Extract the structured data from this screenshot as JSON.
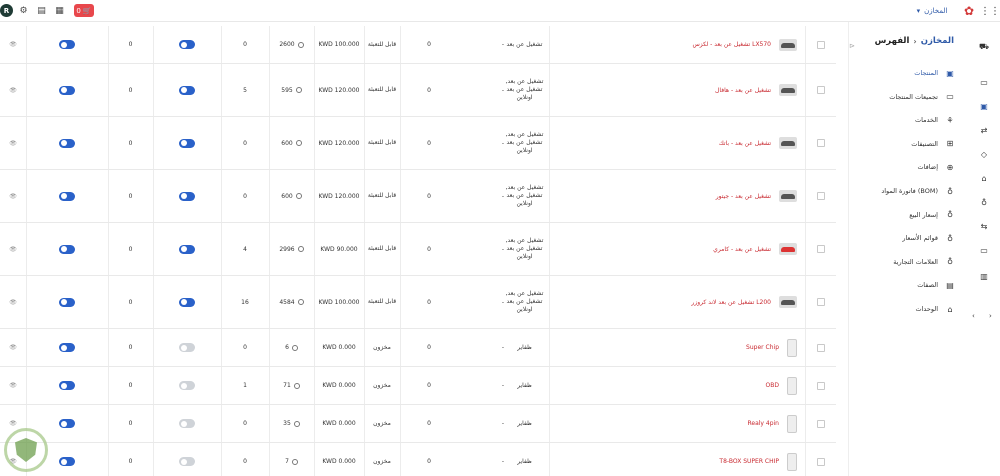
{
  "topbar": {
    "avatar_letter": "R",
    "cart_count": "0",
    "store_select_label": "المخازن",
    "icons": [
      "settings-icon",
      "receipt-icon",
      "qr-icon",
      "cart-icon",
      "brand-logo",
      "apps-grid-icon"
    ]
  },
  "sidebar": {
    "breadcrumb": {
      "root": "المخازن",
      "separator": "›",
      "current": "الفهرس"
    },
    "items": [
      {
        "label": "المنتجات",
        "icon": "product-icon",
        "active": true
      },
      {
        "label": "تجميعات المنتجات",
        "icon": "bundle-icon",
        "active": false
      },
      {
        "label": "الخدمات",
        "icon": "service-icon",
        "active": false
      },
      {
        "label": "التصنيفات",
        "icon": "category-icon",
        "active": false
      },
      {
        "label": "إضافات",
        "icon": "addon-icon",
        "active": false
      },
      {
        "label": "فاتورة المواد (BOM)",
        "icon": "bom-icon",
        "active": false
      },
      {
        "label": "إسعار البيع",
        "icon": "price-icon",
        "active": false
      },
      {
        "label": "قوائم الأسعار",
        "icon": "pricelist-icon",
        "active": false
      },
      {
        "label": "العلامات التجارية",
        "icon": "brand-icon",
        "active": false
      },
      {
        "label": "الصفات",
        "icon": "attribute-icon",
        "active": false
      },
      {
        "label": "الوحدات",
        "icon": "unit-icon",
        "active": false
      }
    ]
  },
  "rail": {
    "icons": [
      "truck-icon",
      "pos-icon",
      "catalog-icon",
      "transfer-icon",
      "tag-icon",
      "store-icon",
      "flow-icon",
      "exchange-icon",
      "card-icon",
      "chart-icon"
    ],
    "arrows": "‹ ›"
  },
  "rows": [
    {
      "name": "تشغيل عن بعد - لكزس LX570",
      "image": "car-dark",
      "type": "تشغيل عن بعد",
      "dash": "-",
      "zero_a": "0",
      "tracking": "قابل للتعبئة",
      "price": "KWD 100.000",
      "stock": "2600",
      "qty": "0",
      "active": true,
      "count": "0",
      "visible": true
    },
    {
      "name": "تشغيل عن بعد - هافال",
      "image": "car-dark",
      "type": "تشغيل عن بعد, تشغيل عن بعد اونلاين",
      "dash": "-",
      "zero_a": "0",
      "tracking": "قابل للتعبئة",
      "price": "KWD 120.000",
      "stock": "595",
      "qty": "5",
      "active": true,
      "count": "0",
      "visible": true
    },
    {
      "name": "تشغيل عن بعد - باتك",
      "image": "car-light",
      "type": "تشغيل عن بعد, تشغيل عن بعد اونلاين",
      "dash": "-",
      "zero_a": "0",
      "tracking": "قابل للتعبئة",
      "price": "KWD 120.000",
      "stock": "600",
      "qty": "0",
      "active": true,
      "count": "0",
      "visible": true
    },
    {
      "name": "تشغيل عن بعد - جيتور",
      "image": "car-dark",
      "type": "تشغيل عن بعد, تشغيل عن بعد اونلاين",
      "dash": "-",
      "zero_a": "0",
      "tracking": "قابل للتعبئة",
      "price": "KWD 120.000",
      "stock": "600",
      "qty": "0",
      "active": true,
      "count": "0",
      "visible": true
    },
    {
      "name": "تشغيل عن بعد - كامري",
      "image": "car-red",
      "type": "تشغيل عن بعد, تشغيل عن بعد اونلاين",
      "dash": "-",
      "zero_a": "0",
      "tracking": "قابل للتعبئة",
      "price": "KWD 90.000",
      "stock": "2996",
      "qty": "4",
      "active": true,
      "count": "0",
      "visible": true
    },
    {
      "name": "تشغيل عن بعد لاند كروزر L200",
      "image": "car-dark",
      "type": "تشغيل عن بعد, تشغيل عن بعد اونلاين",
      "dash": "-",
      "zero_a": "0",
      "tracking": "قابل للتعبئة",
      "price": "KWD 100.000",
      "stock": "4584",
      "qty": "16",
      "active": true,
      "count": "0",
      "visible": true
    },
    {
      "name": "Super Chip",
      "image": "device",
      "type": "ظفاير",
      "dash": "-",
      "zero_a": "0",
      "tracking": "مخزون",
      "price": "KWD 0.000",
      "stock": "6",
      "qty": "0",
      "active": false,
      "count": "0",
      "visible": true
    },
    {
      "name": "OBD",
      "image": "device",
      "type": "ظفاير",
      "dash": "-",
      "zero_a": "0",
      "tracking": "مخزون",
      "price": "KWD 0.000",
      "stock": "71",
      "qty": "1",
      "active": false,
      "count": "0",
      "visible": true
    },
    {
      "name": "Realy 4pin",
      "image": "device",
      "type": "ظفاير",
      "dash": "-",
      "zero_a": "0",
      "tracking": "مخزون",
      "price": "KWD 0.000",
      "stock": "35",
      "qty": "0",
      "active": false,
      "count": "0",
      "visible": true
    },
    {
      "name": "T8-BOX SUPER CHIP",
      "image": "device",
      "type": "ظفاير",
      "dash": "-",
      "zero_a": "0",
      "tracking": "مخزون",
      "price": "KWD 0.000",
      "stock": "7",
      "qty": "0",
      "active": false,
      "count": "0",
      "visible": true
    }
  ]
}
